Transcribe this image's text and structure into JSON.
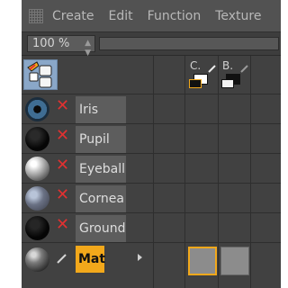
{
  "menubar": {
    "items": [
      "Create",
      "Edit",
      "Function",
      "Texture"
    ]
  },
  "zoom": {
    "value": "100 %",
    "stepper_icon": "up-down-stepper-icon"
  },
  "columns": [
    {
      "label": "C.",
      "pen": true
    },
    {
      "label": "B.",
      "pen": true
    }
  ],
  "objects": [
    {
      "name": "Iris",
      "thumb": "iris-eye-icon",
      "disabled": true
    },
    {
      "name": "Pupil",
      "thumb": "black-sphere-icon",
      "disabled": true
    },
    {
      "name": "Eyeball",
      "thumb": "shiny-sphere-icon",
      "disabled": true
    },
    {
      "name": "Cornea",
      "thumb": "glass-sphere-icon",
      "disabled": true
    },
    {
      "name": "Ground",
      "thumb": "black-sphere-icon",
      "disabled": true
    }
  ],
  "material": {
    "name": "Mat",
    "thumb": "shaded-sphere-icon",
    "selected": true
  },
  "colors": {
    "accent": "#f2a81b",
    "disabled_x": "#e03131",
    "panel_bg": "#414141"
  }
}
